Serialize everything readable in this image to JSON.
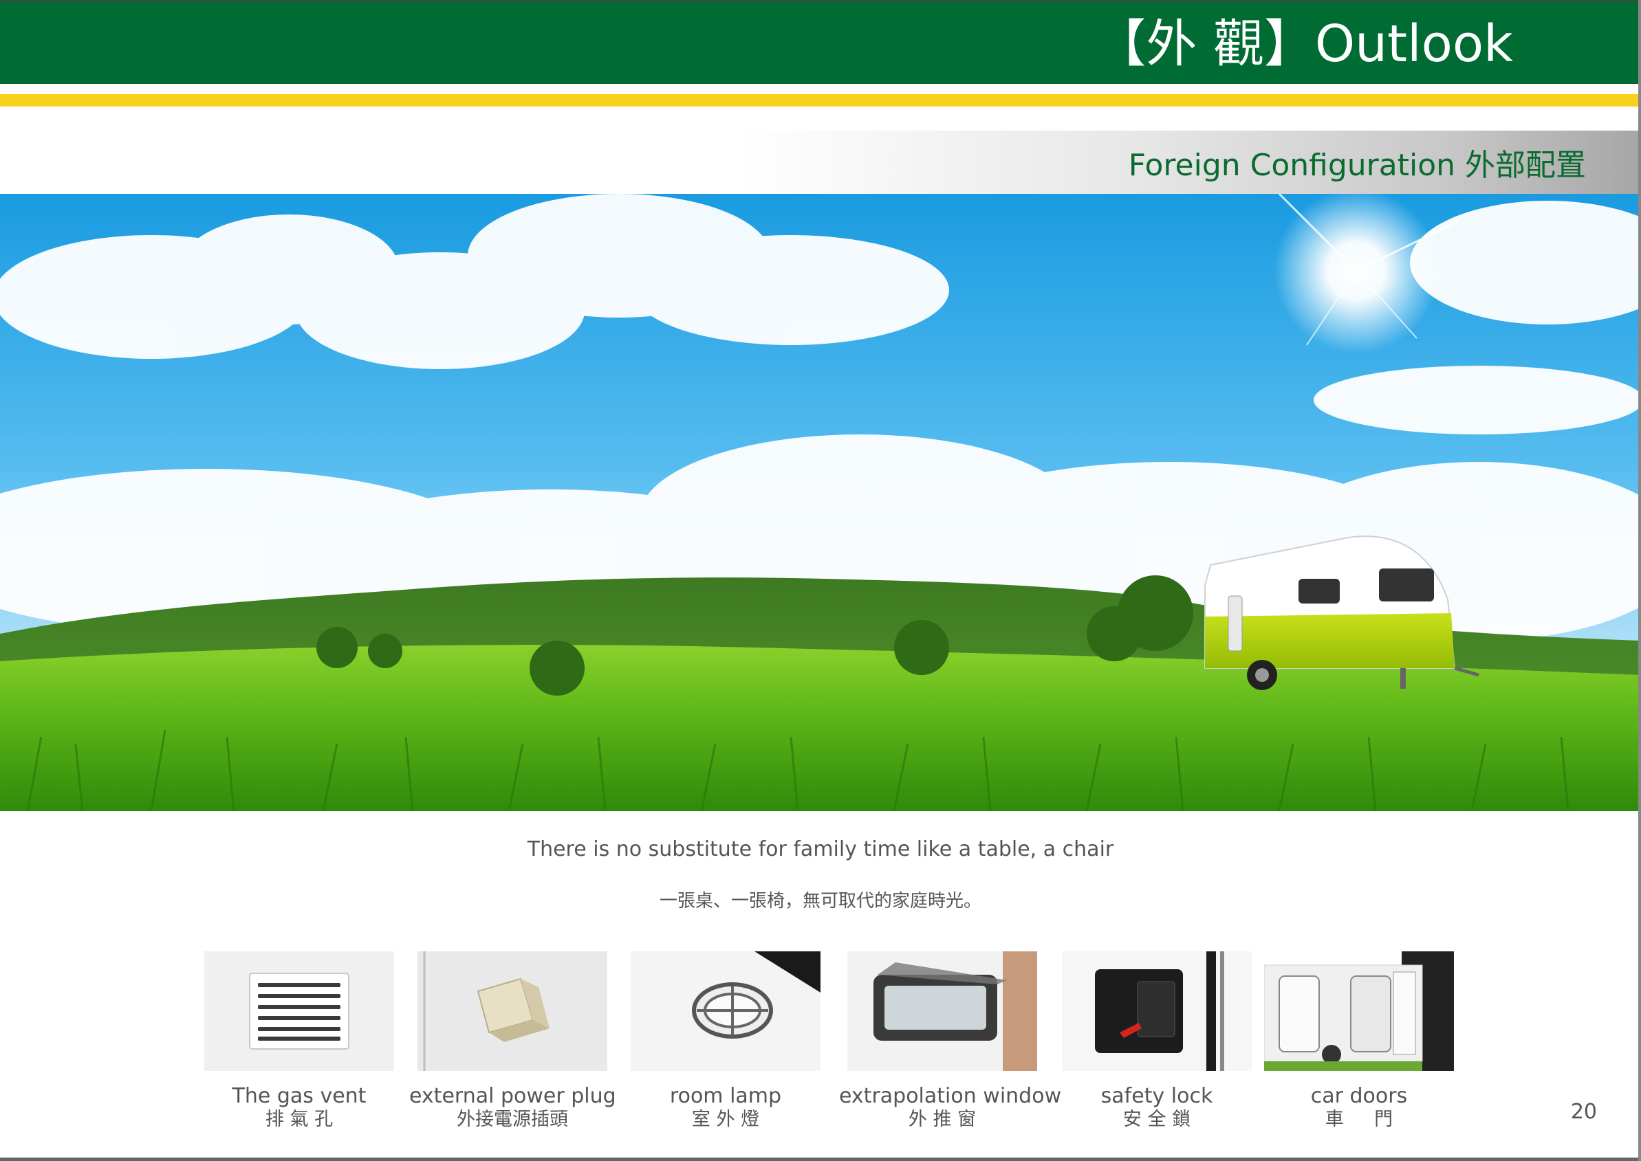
{
  "header": {
    "title": "【外 觀】Outlook"
  },
  "subheader": {
    "title": "Foreign Configuration 外部配置"
  },
  "hero": {
    "description": ""
  },
  "tagline": {
    "english": "There is no substitute for family time like a table, a chair",
    "chinese": "一張桌、一張椅，無可取代的家庭時光。"
  },
  "features": [
    {
      "label_en": "The gas vent",
      "label_zh": "排 氣 孔",
      "icon": "vent-icon"
    },
    {
      "label_en": "external power plug",
      "label_zh": "外接電源插頭",
      "icon": "plug-icon"
    },
    {
      "label_en": "room lamp",
      "label_zh": "室 外 燈",
      "icon": "lamp-icon"
    },
    {
      "label_en": "extrapolation window",
      "label_zh": "外 推 窗",
      "icon": "window-icon"
    },
    {
      "label_en": "safety lock",
      "label_zh": "安 全 鎖",
      "icon": "lock-icon"
    },
    {
      "label_en": "car doors",
      "label_zh": "車 　 門",
      "icon": "door-icon"
    }
  ],
  "page_number": "20",
  "colors": {
    "brand_green": "#006b32",
    "accent_yellow": "#f6d21c",
    "trailer_lime": "#a8cc0c"
  }
}
